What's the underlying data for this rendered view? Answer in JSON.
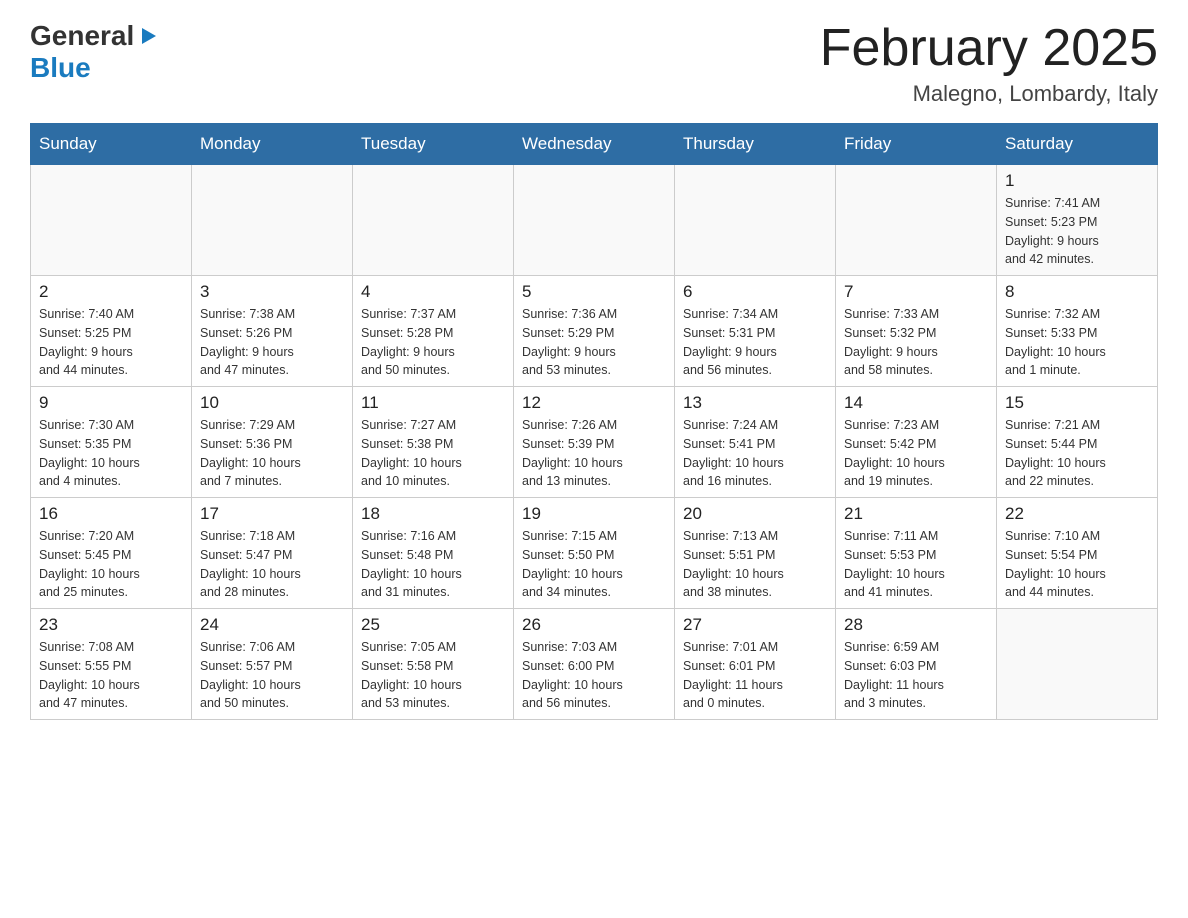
{
  "logo": {
    "general": "General",
    "blue": "Blue",
    "arrow": "▶"
  },
  "title": "February 2025",
  "location": "Malegno, Lombardy, Italy",
  "weekdays": [
    "Sunday",
    "Monday",
    "Tuesday",
    "Wednesday",
    "Thursday",
    "Friday",
    "Saturday"
  ],
  "weeks": [
    [
      {
        "day": "",
        "info": ""
      },
      {
        "day": "",
        "info": ""
      },
      {
        "day": "",
        "info": ""
      },
      {
        "day": "",
        "info": ""
      },
      {
        "day": "",
        "info": ""
      },
      {
        "day": "",
        "info": ""
      },
      {
        "day": "1",
        "info": "Sunrise: 7:41 AM\nSunset: 5:23 PM\nDaylight: 9 hours\nand 42 minutes."
      }
    ],
    [
      {
        "day": "2",
        "info": "Sunrise: 7:40 AM\nSunset: 5:25 PM\nDaylight: 9 hours\nand 44 minutes."
      },
      {
        "day": "3",
        "info": "Sunrise: 7:38 AM\nSunset: 5:26 PM\nDaylight: 9 hours\nand 47 minutes."
      },
      {
        "day": "4",
        "info": "Sunrise: 7:37 AM\nSunset: 5:28 PM\nDaylight: 9 hours\nand 50 minutes."
      },
      {
        "day": "5",
        "info": "Sunrise: 7:36 AM\nSunset: 5:29 PM\nDaylight: 9 hours\nand 53 minutes."
      },
      {
        "day": "6",
        "info": "Sunrise: 7:34 AM\nSunset: 5:31 PM\nDaylight: 9 hours\nand 56 minutes."
      },
      {
        "day": "7",
        "info": "Sunrise: 7:33 AM\nSunset: 5:32 PM\nDaylight: 9 hours\nand 58 minutes."
      },
      {
        "day": "8",
        "info": "Sunrise: 7:32 AM\nSunset: 5:33 PM\nDaylight: 10 hours\nand 1 minute."
      }
    ],
    [
      {
        "day": "9",
        "info": "Sunrise: 7:30 AM\nSunset: 5:35 PM\nDaylight: 10 hours\nand 4 minutes."
      },
      {
        "day": "10",
        "info": "Sunrise: 7:29 AM\nSunset: 5:36 PM\nDaylight: 10 hours\nand 7 minutes."
      },
      {
        "day": "11",
        "info": "Sunrise: 7:27 AM\nSunset: 5:38 PM\nDaylight: 10 hours\nand 10 minutes."
      },
      {
        "day": "12",
        "info": "Sunrise: 7:26 AM\nSunset: 5:39 PM\nDaylight: 10 hours\nand 13 minutes."
      },
      {
        "day": "13",
        "info": "Sunrise: 7:24 AM\nSunset: 5:41 PM\nDaylight: 10 hours\nand 16 minutes."
      },
      {
        "day": "14",
        "info": "Sunrise: 7:23 AM\nSunset: 5:42 PM\nDaylight: 10 hours\nand 19 minutes."
      },
      {
        "day": "15",
        "info": "Sunrise: 7:21 AM\nSunset: 5:44 PM\nDaylight: 10 hours\nand 22 minutes."
      }
    ],
    [
      {
        "day": "16",
        "info": "Sunrise: 7:20 AM\nSunset: 5:45 PM\nDaylight: 10 hours\nand 25 minutes."
      },
      {
        "day": "17",
        "info": "Sunrise: 7:18 AM\nSunset: 5:47 PM\nDaylight: 10 hours\nand 28 minutes."
      },
      {
        "day": "18",
        "info": "Sunrise: 7:16 AM\nSunset: 5:48 PM\nDaylight: 10 hours\nand 31 minutes."
      },
      {
        "day": "19",
        "info": "Sunrise: 7:15 AM\nSunset: 5:50 PM\nDaylight: 10 hours\nand 34 minutes."
      },
      {
        "day": "20",
        "info": "Sunrise: 7:13 AM\nSunset: 5:51 PM\nDaylight: 10 hours\nand 38 minutes."
      },
      {
        "day": "21",
        "info": "Sunrise: 7:11 AM\nSunset: 5:53 PM\nDaylight: 10 hours\nand 41 minutes."
      },
      {
        "day": "22",
        "info": "Sunrise: 7:10 AM\nSunset: 5:54 PM\nDaylight: 10 hours\nand 44 minutes."
      }
    ],
    [
      {
        "day": "23",
        "info": "Sunrise: 7:08 AM\nSunset: 5:55 PM\nDaylight: 10 hours\nand 47 minutes."
      },
      {
        "day": "24",
        "info": "Sunrise: 7:06 AM\nSunset: 5:57 PM\nDaylight: 10 hours\nand 50 minutes."
      },
      {
        "day": "25",
        "info": "Sunrise: 7:05 AM\nSunset: 5:58 PM\nDaylight: 10 hours\nand 53 minutes."
      },
      {
        "day": "26",
        "info": "Sunrise: 7:03 AM\nSunset: 6:00 PM\nDaylight: 10 hours\nand 56 minutes."
      },
      {
        "day": "27",
        "info": "Sunrise: 7:01 AM\nSunset: 6:01 PM\nDaylight: 11 hours\nand 0 minutes."
      },
      {
        "day": "28",
        "info": "Sunrise: 6:59 AM\nSunset: 6:03 PM\nDaylight: 11 hours\nand 3 minutes."
      },
      {
        "day": "",
        "info": ""
      }
    ]
  ]
}
